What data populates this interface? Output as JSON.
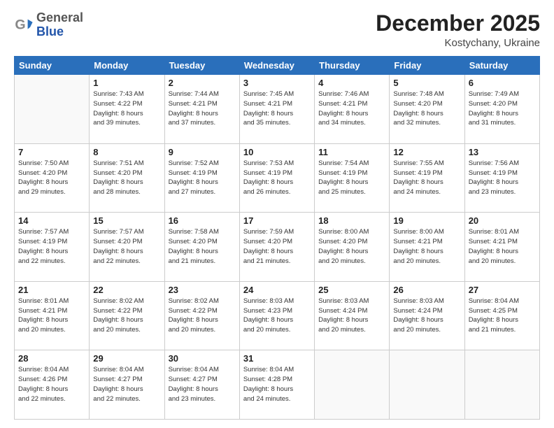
{
  "header": {
    "logo": {
      "general": "General",
      "blue": "Blue"
    },
    "title": "December 2025",
    "location": "Kostychany, Ukraine"
  },
  "days_of_week": [
    "Sunday",
    "Monday",
    "Tuesday",
    "Wednesday",
    "Thursday",
    "Friday",
    "Saturday"
  ],
  "weeks": [
    [
      {
        "day": "",
        "info": ""
      },
      {
        "day": "1",
        "info": "Sunrise: 7:43 AM\nSunset: 4:22 PM\nDaylight: 8 hours\nand 39 minutes."
      },
      {
        "day": "2",
        "info": "Sunrise: 7:44 AM\nSunset: 4:21 PM\nDaylight: 8 hours\nand 37 minutes."
      },
      {
        "day": "3",
        "info": "Sunrise: 7:45 AM\nSunset: 4:21 PM\nDaylight: 8 hours\nand 35 minutes."
      },
      {
        "day": "4",
        "info": "Sunrise: 7:46 AM\nSunset: 4:21 PM\nDaylight: 8 hours\nand 34 minutes."
      },
      {
        "day": "5",
        "info": "Sunrise: 7:48 AM\nSunset: 4:20 PM\nDaylight: 8 hours\nand 32 minutes."
      },
      {
        "day": "6",
        "info": "Sunrise: 7:49 AM\nSunset: 4:20 PM\nDaylight: 8 hours\nand 31 minutes."
      }
    ],
    [
      {
        "day": "7",
        "info": "Sunrise: 7:50 AM\nSunset: 4:20 PM\nDaylight: 8 hours\nand 29 minutes."
      },
      {
        "day": "8",
        "info": "Sunrise: 7:51 AM\nSunset: 4:20 PM\nDaylight: 8 hours\nand 28 minutes."
      },
      {
        "day": "9",
        "info": "Sunrise: 7:52 AM\nSunset: 4:19 PM\nDaylight: 8 hours\nand 27 minutes."
      },
      {
        "day": "10",
        "info": "Sunrise: 7:53 AM\nSunset: 4:19 PM\nDaylight: 8 hours\nand 26 minutes."
      },
      {
        "day": "11",
        "info": "Sunrise: 7:54 AM\nSunset: 4:19 PM\nDaylight: 8 hours\nand 25 minutes."
      },
      {
        "day": "12",
        "info": "Sunrise: 7:55 AM\nSunset: 4:19 PM\nDaylight: 8 hours\nand 24 minutes."
      },
      {
        "day": "13",
        "info": "Sunrise: 7:56 AM\nSunset: 4:19 PM\nDaylight: 8 hours\nand 23 minutes."
      }
    ],
    [
      {
        "day": "14",
        "info": "Sunrise: 7:57 AM\nSunset: 4:19 PM\nDaylight: 8 hours\nand 22 minutes."
      },
      {
        "day": "15",
        "info": "Sunrise: 7:57 AM\nSunset: 4:20 PM\nDaylight: 8 hours\nand 22 minutes."
      },
      {
        "day": "16",
        "info": "Sunrise: 7:58 AM\nSunset: 4:20 PM\nDaylight: 8 hours\nand 21 minutes."
      },
      {
        "day": "17",
        "info": "Sunrise: 7:59 AM\nSunset: 4:20 PM\nDaylight: 8 hours\nand 21 minutes."
      },
      {
        "day": "18",
        "info": "Sunrise: 8:00 AM\nSunset: 4:20 PM\nDaylight: 8 hours\nand 20 minutes."
      },
      {
        "day": "19",
        "info": "Sunrise: 8:00 AM\nSunset: 4:21 PM\nDaylight: 8 hours\nand 20 minutes."
      },
      {
        "day": "20",
        "info": "Sunrise: 8:01 AM\nSunset: 4:21 PM\nDaylight: 8 hours\nand 20 minutes."
      }
    ],
    [
      {
        "day": "21",
        "info": "Sunrise: 8:01 AM\nSunset: 4:21 PM\nDaylight: 8 hours\nand 20 minutes."
      },
      {
        "day": "22",
        "info": "Sunrise: 8:02 AM\nSunset: 4:22 PM\nDaylight: 8 hours\nand 20 minutes."
      },
      {
        "day": "23",
        "info": "Sunrise: 8:02 AM\nSunset: 4:22 PM\nDaylight: 8 hours\nand 20 minutes."
      },
      {
        "day": "24",
        "info": "Sunrise: 8:03 AM\nSunset: 4:23 PM\nDaylight: 8 hours\nand 20 minutes."
      },
      {
        "day": "25",
        "info": "Sunrise: 8:03 AM\nSunset: 4:24 PM\nDaylight: 8 hours\nand 20 minutes."
      },
      {
        "day": "26",
        "info": "Sunrise: 8:03 AM\nSunset: 4:24 PM\nDaylight: 8 hours\nand 20 minutes."
      },
      {
        "day": "27",
        "info": "Sunrise: 8:04 AM\nSunset: 4:25 PM\nDaylight: 8 hours\nand 21 minutes."
      }
    ],
    [
      {
        "day": "28",
        "info": "Sunrise: 8:04 AM\nSunset: 4:26 PM\nDaylight: 8 hours\nand 22 minutes."
      },
      {
        "day": "29",
        "info": "Sunrise: 8:04 AM\nSunset: 4:27 PM\nDaylight: 8 hours\nand 22 minutes."
      },
      {
        "day": "30",
        "info": "Sunrise: 8:04 AM\nSunset: 4:27 PM\nDaylight: 8 hours\nand 23 minutes."
      },
      {
        "day": "31",
        "info": "Sunrise: 8:04 AM\nSunset: 4:28 PM\nDaylight: 8 hours\nand 24 minutes."
      },
      {
        "day": "",
        "info": ""
      },
      {
        "day": "",
        "info": ""
      },
      {
        "day": "",
        "info": ""
      }
    ]
  ]
}
